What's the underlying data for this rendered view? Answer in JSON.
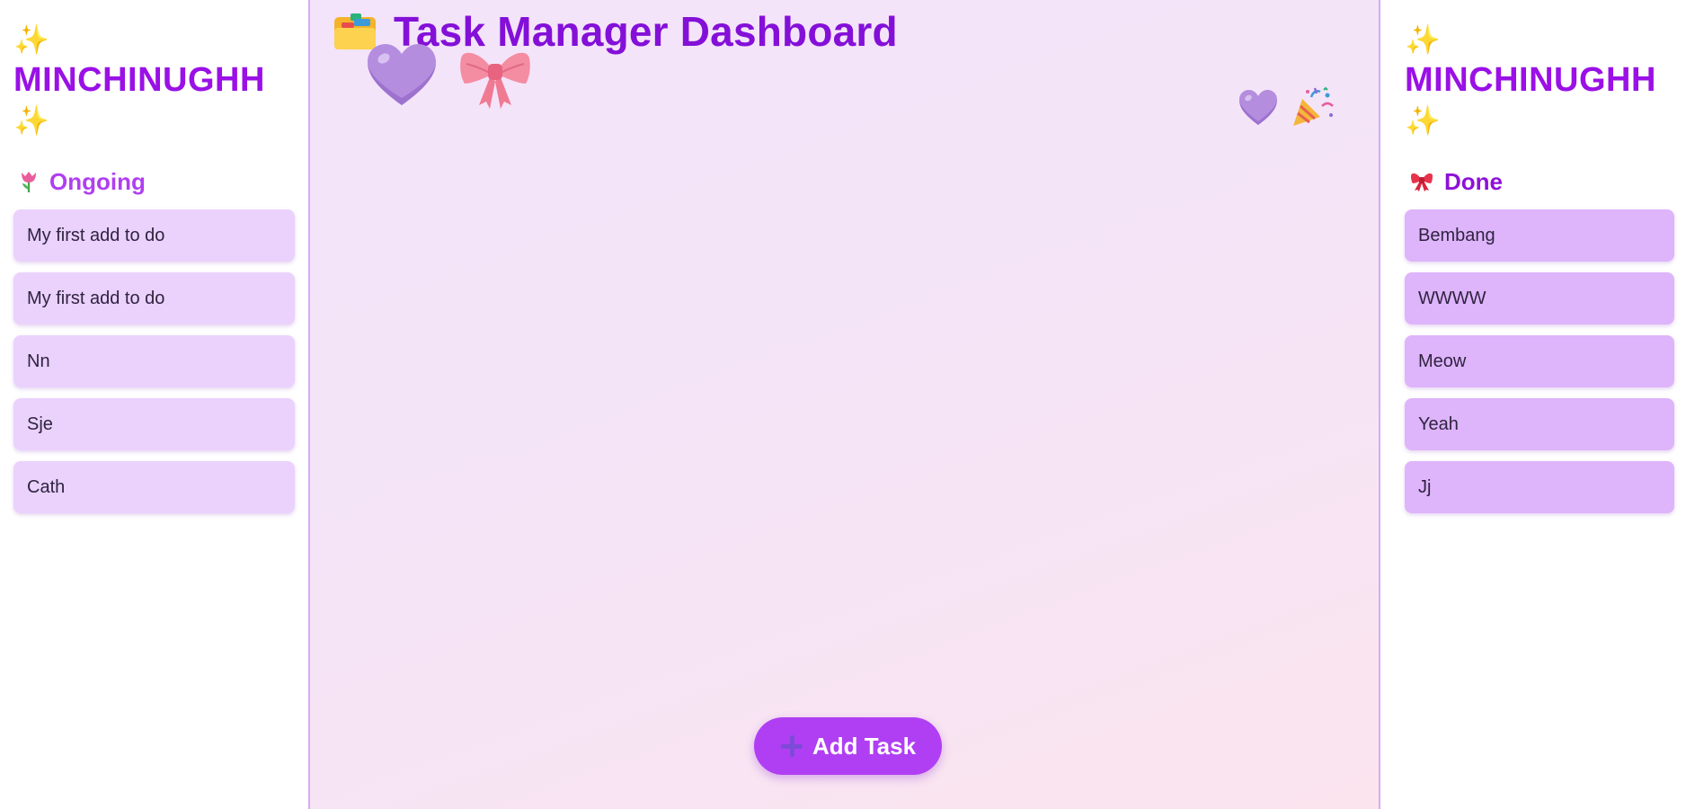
{
  "left_sidebar": {
    "brand_prefix_icon": "sparkles-icon",
    "brand": "MINCHINUGHH",
    "brand_suffix_icon": "sparkles-icon",
    "section_icon": "tulip-icon",
    "section_title": "Ongoing",
    "tasks": [
      "My first add to do",
      "My first add to do",
      "Nn",
      "Sje",
      "Cath"
    ]
  },
  "main": {
    "title_icon": "card-index-dividers-icon",
    "title": "Task Manager Dashboard",
    "decorations": [
      "purple-heart-icon",
      "ribbon-bow-icon",
      "purple-heart-icon",
      "party-popper-icon"
    ],
    "add_button": {
      "icon": "plus-icon",
      "label": "Add Task"
    }
  },
  "right_sidebar": {
    "brand_prefix_icon": "sparkles-icon",
    "brand": "MINCHINUGHH",
    "brand_suffix_icon": "sparkles-icon",
    "section_icon": "ribbon-icon",
    "section_title": "Done",
    "tasks": [
      "Bembang",
      "WWWW",
      "Meow",
      "Yeah",
      "Jj"
    ]
  },
  "colors": {
    "brand": "#9a10e6",
    "ongoing_card": "#ead2fd",
    "done_card": "#deb4fb",
    "accent_button": "#b03ff3",
    "title": "#8410d8"
  }
}
